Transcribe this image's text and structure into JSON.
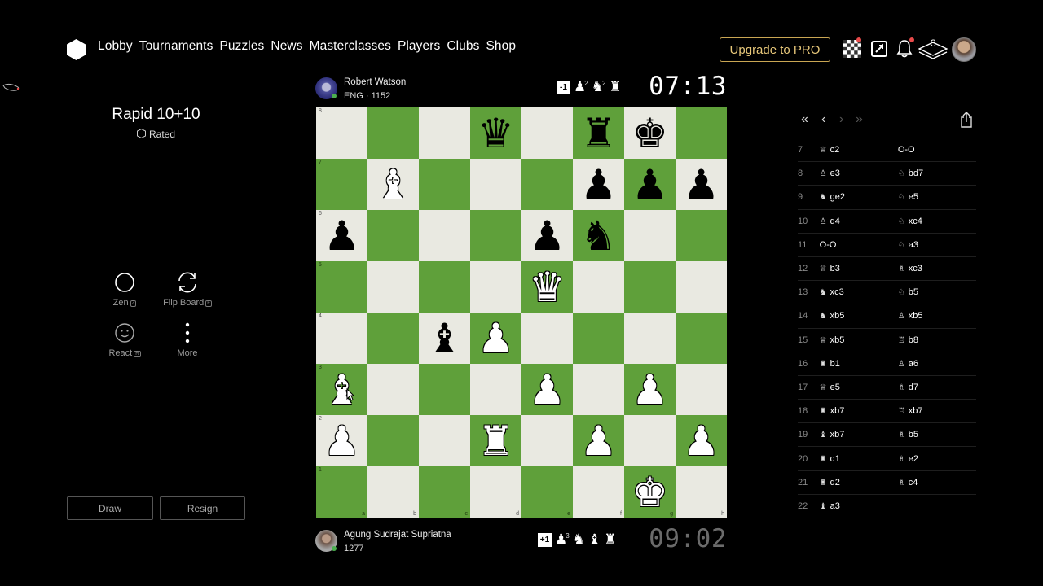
{
  "nav": {
    "items": [
      "Lobby",
      "Tournaments",
      "Puzzles",
      "News",
      "Masterclasses",
      "Players",
      "Clubs",
      "Shop"
    ],
    "upgrade_label": "Upgrade to PRO",
    "layers_count": "3"
  },
  "game": {
    "title": "Rapid 10+10",
    "rated_label": "Rated"
  },
  "tools": {
    "zen_label": "Zen",
    "zen_key": "Z",
    "flip_label": "Flip Board",
    "flip_key": "F",
    "react_label": "React",
    "react_key": "R",
    "more_label": "More"
  },
  "actions": {
    "draw_label": "Draw",
    "resign_label": "Resign"
  },
  "players": {
    "top": {
      "name": "Robert Watson",
      "meta": "ENG · 1152",
      "advantage": "-1",
      "captured": [
        {
          "glyph": "♟",
          "count": "2"
        },
        {
          "glyph": "♞",
          "count": "2"
        },
        {
          "glyph": "♜",
          "count": ""
        }
      ],
      "clock": "07:13"
    },
    "bottom": {
      "name": "Agung Sudrajat Supriatna",
      "meta": "1277",
      "advantage": "+1",
      "captured": [
        {
          "glyph": "♟",
          "count": "3"
        },
        {
          "glyph": "♞",
          "count": ""
        },
        {
          "glyph": "♝",
          "count": ""
        },
        {
          "glyph": "♜",
          "count": ""
        }
      ],
      "clock": "09:02"
    }
  },
  "board": {
    "files": [
      "a",
      "b",
      "c",
      "d",
      "e",
      "f",
      "g",
      "h"
    ],
    "ranks": [
      "8",
      "7",
      "6",
      "5",
      "4",
      "3",
      "2",
      "1"
    ],
    "rows": [
      [
        "",
        "",
        "",
        "bq",
        "",
        "br",
        "bk",
        ""
      ],
      [
        "",
        "wb",
        "",
        "",
        "",
        "bp",
        "bp",
        "bp"
      ],
      [
        "bp",
        "",
        "",
        "",
        "bp",
        "bn",
        "",
        ""
      ],
      [
        "",
        "",
        "",
        "",
        "wq",
        "",
        "",
        ""
      ],
      [
        "",
        "",
        "bb",
        "wp",
        "",
        "",
        "",
        ""
      ],
      [
        "wb",
        "",
        "",
        "",
        "wp",
        "",
        "wp",
        ""
      ],
      [
        "wp",
        "",
        "",
        "wr",
        "",
        "wp",
        "",
        "wp"
      ],
      [
        "",
        "",
        "",
        "",
        "",
        "",
        "wk",
        ""
      ]
    ],
    "glyphs": {
      "k": "♚",
      "q": "♛",
      "r": "♜",
      "b": "♝",
      "n": "♞",
      "p": "♟"
    },
    "colors": {
      "light": "#e9e9e1",
      "dark": "#5fa03a"
    }
  },
  "move_nav": {
    "first": "«",
    "prev": "‹",
    "next": "›",
    "last": "»"
  },
  "moves": [
    {
      "n": "7",
      "w": "c2",
      "wp": "♕",
      "b": "O-O",
      "bp": ""
    },
    {
      "n": "8",
      "w": "e3",
      "wp": "♙",
      "b": "bd7",
      "bp": "♘"
    },
    {
      "n": "9",
      "w": "ge2",
      "wp": "♞",
      "b": "e5",
      "bp": "♘"
    },
    {
      "n": "10",
      "w": "d4",
      "wp": "♙",
      "b": "xc4",
      "bp": "♘"
    },
    {
      "n": "11",
      "w": "O-O",
      "wp": "",
      "b": "a3",
      "bp": "♘"
    },
    {
      "n": "12",
      "w": "b3",
      "wp": "♕",
      "b": "xc3",
      "bp": "♗"
    },
    {
      "n": "13",
      "w": "xc3",
      "wp": "♞",
      "b": "b5",
      "bp": "♘"
    },
    {
      "n": "14",
      "w": "xb5",
      "wp": "♞",
      "b": "xb5",
      "bp": "♙"
    },
    {
      "n": "15",
      "w": "xb5",
      "wp": "♕",
      "b": "b8",
      "bp": "♖"
    },
    {
      "n": "16",
      "w": "b1",
      "wp": "♜",
      "b": "a6",
      "bp": "♙"
    },
    {
      "n": "17",
      "w": "e5",
      "wp": "♕",
      "b": "d7",
      "bp": "♗"
    },
    {
      "n": "18",
      "w": "xb7",
      "wp": "♜",
      "b": "xb7",
      "bp": "♖"
    },
    {
      "n": "19",
      "w": "xb7",
      "wp": "♝",
      "b": "b5",
      "bp": "♗"
    },
    {
      "n": "20",
      "w": "d1",
      "wp": "♜",
      "b": "e2",
      "bp": "♗"
    },
    {
      "n": "21",
      "w": "d2",
      "wp": "♜",
      "b": "c4",
      "bp": "♗"
    },
    {
      "n": "22",
      "w": "a3",
      "wp": "♝",
      "b": "",
      "bp": ""
    }
  ]
}
